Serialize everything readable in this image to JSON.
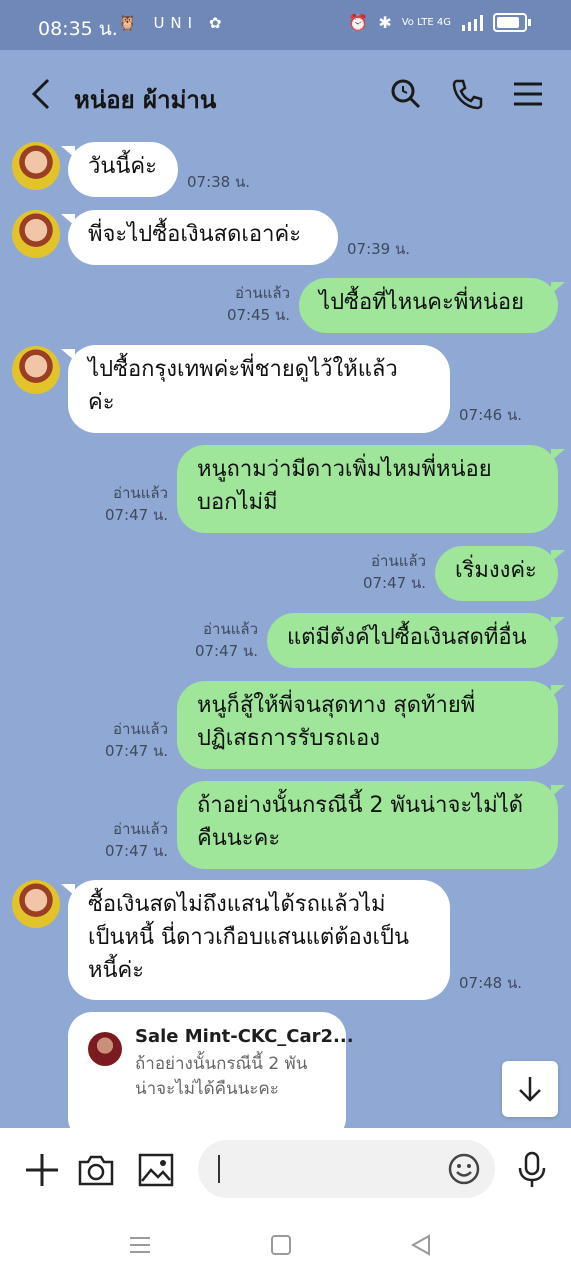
{
  "status_bar": {
    "time": "08:35 น.",
    "left_icons": "🦉 UNI ✿",
    "network": "Vo LTE 4G"
  },
  "header": {
    "title": "หน่อย ผ้าม่าน",
    "icons": [
      "back-arrow-icon",
      "search-icon",
      "phone-icon",
      "menu-icon"
    ]
  },
  "messages": [
    {
      "side": "in",
      "text": "วันนี้ค่ะ",
      "time": "07:38 น."
    },
    {
      "side": "in",
      "text": "พี่จะไปซื้อเงินสดเอาค่ะ",
      "time": "07:39 น."
    },
    {
      "side": "out",
      "read": "อ่านแล้ว",
      "text": "ไปซื้อที่ไหนคะพี่หน่อย",
      "time": "07:45 น."
    },
    {
      "side": "in",
      "lines": [
        "ไปซื้อกรุงเทพค่ะพี่ชายดูไว้ให้แล้ว",
        "ค่ะ"
      ],
      "time": "07:46 น."
    },
    {
      "side": "out",
      "read": "อ่านแล้ว",
      "lines": [
        "หนูถามว่ามีดาวเพิ่มไหมพี่หน่อย",
        "บอกไม่มี"
      ],
      "time": "07:47 น."
    },
    {
      "side": "out",
      "read": "อ่านแล้ว",
      "text": "เริ่มงงค่ะ",
      "time": "07:47 น."
    },
    {
      "side": "out",
      "read": "อ่านแล้ว",
      "text": "แต่มีตังค์ไปซื้อเงินสดที่อื่น",
      "time": "07:47 น."
    },
    {
      "side": "out",
      "read": "อ่านแล้ว",
      "lines": [
        "หนูก็สู้ให้พี่จนสุดทาง สุดท้ายพี่",
        "ปฏิเสธการรับรถเอง"
      ],
      "time": "07:47 น."
    },
    {
      "side": "out",
      "read": "อ่านแล้ว",
      "lines": [
        "ถ้าอย่างนั้นกรณีนี้ 2 พันน่าจะไม่ได้",
        "คืนนะคะ"
      ],
      "time": "07:47 น."
    },
    {
      "side": "in",
      "lines": [
        "ซื้อเงินสดไม่ถึงแสนได้รถแล้วไม่",
        "เป็นหนี้ นี่ดาวเกือบแสนแต่ต้องเป็น",
        "หนี้ค่ะ"
      ],
      "time": "07:48 น."
    }
  ],
  "reply_preview": {
    "name": "Sale Mint-CKC_Car2...",
    "lines": [
      "ถ้าอย่างนั้นกรณีนี้ 2 พัน",
      "น่าจะไม่ได้คืนนะคะ"
    ]
  },
  "input_bar": {
    "icons": [
      "plus-icon",
      "camera-icon",
      "image-icon",
      "emoji-icon",
      "microphone-icon"
    ],
    "value": ""
  },
  "nav_bar": {
    "icons": [
      "recent-apps-icon",
      "home-icon",
      "back-icon"
    ]
  },
  "colors": {
    "chat_background": "#8fa9d4",
    "outgoing_bubble": "#9fe59a",
    "incoming_bubble": "#ffffff",
    "status_bar": "#6f88b8"
  }
}
